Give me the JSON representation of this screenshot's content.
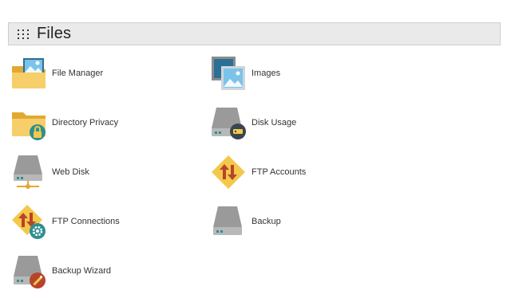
{
  "section": {
    "title": "Files"
  },
  "items": [
    {
      "label": "File Manager",
      "icon": "folder-image-icon"
    },
    {
      "label": "Images",
      "icon": "images-icon"
    },
    {
      "label": "Directory Privacy",
      "icon": "folder-lock-icon"
    },
    {
      "label": "Disk Usage",
      "icon": "disk-usage-icon"
    },
    {
      "label": "Web Disk",
      "icon": "web-disk-icon"
    },
    {
      "label": "FTP Accounts",
      "icon": "ftp-accounts-icon"
    },
    {
      "label": "FTP Connections",
      "icon": "ftp-connections-icon"
    },
    {
      "label": "Backup",
      "icon": "backup-icon"
    },
    {
      "label": "Backup Wizard",
      "icon": "backup-wizard-icon"
    }
  ],
  "colors": {
    "folder": "#f2c14b",
    "folder_dark": "#e3a832",
    "blue": "#5aa9d6",
    "disk": "#9a9a9a",
    "disk_dark": "#6e6e6e",
    "diamond": "#f3c84b",
    "arrow": "#b8432b",
    "teal": "#2f8f8f"
  }
}
